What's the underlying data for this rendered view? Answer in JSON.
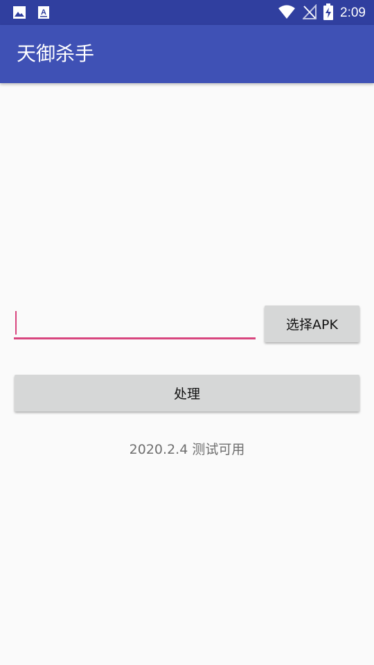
{
  "status_bar": {
    "time": "2:09",
    "icons": [
      "image-notification-icon",
      "text-notification-icon",
      "wifi-icon",
      "no-signal-icon",
      "battery-charging-icon"
    ]
  },
  "app_bar": {
    "title": "天御杀手",
    "color": "#3f51b5"
  },
  "form": {
    "apk_path_value": "",
    "select_apk_label": "选择APK",
    "process_label": "处理",
    "accent_color": "#d8457e"
  },
  "footer": {
    "version_text": "2020.2.4 测试可用"
  }
}
